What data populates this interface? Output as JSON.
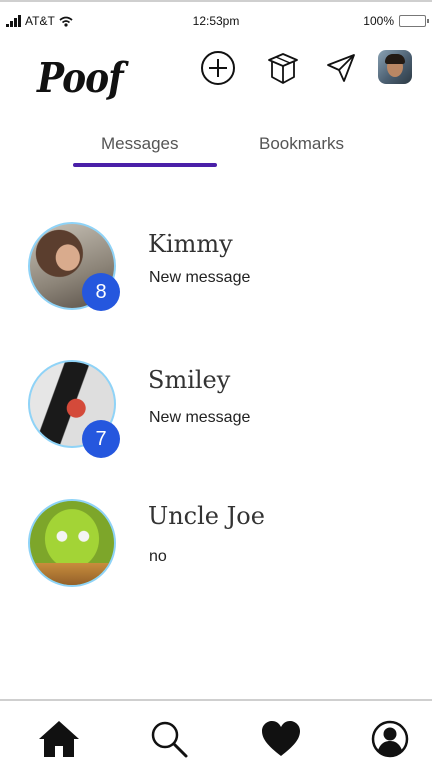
{
  "status_bar": {
    "carrier": "AT&T",
    "time": "12:53pm",
    "battery": "100%",
    "battery_level": 1.0,
    "battery_color": "#4cd964"
  },
  "header": {
    "logo": "Poof",
    "icons": [
      "plus-circle-icon",
      "box-icon",
      "send-icon"
    ],
    "avatar": "profile-avatar"
  },
  "tabs": [
    {
      "label": "Messages",
      "active": true
    },
    {
      "label": "Bookmarks",
      "active": false
    }
  ],
  "conversations": [
    {
      "name": "Kimmy",
      "preview": "New message",
      "unread": "8"
    },
    {
      "name": "Smiley",
      "preview": "New message",
      "unread": "7"
    },
    {
      "name": "Uncle Joe",
      "preview": "no",
      "unread": ""
    }
  ],
  "bottom_nav": [
    "home-icon",
    "search-icon",
    "heart-icon",
    "profile-icon"
  ],
  "colors": {
    "accent": "#4a1fa8",
    "badge": "#2557de",
    "avatar_ring": "#8fd3f7"
  }
}
